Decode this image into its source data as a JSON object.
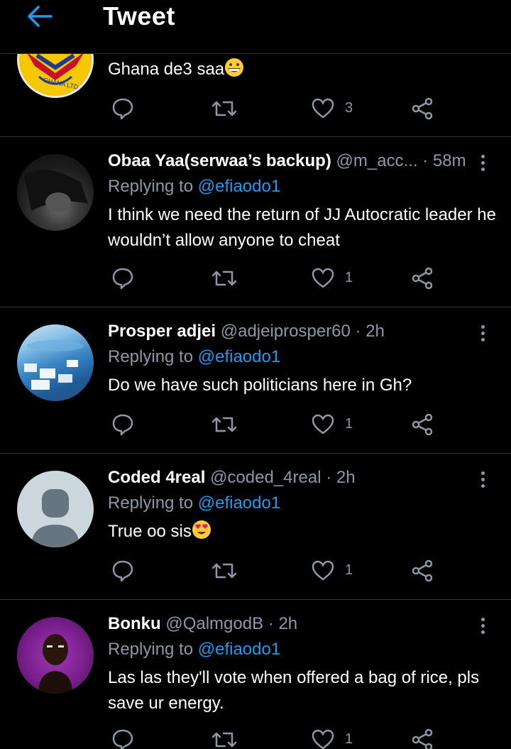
{
  "header": {
    "title": "Tweet"
  },
  "tweets": [
    {
      "text": "Ghana de3 saa",
      "emoji": "grinning-face-emoji",
      "likes": "3",
      "avatar_label": "GHANA LTD"
    },
    {
      "name": "Obaa Yaa(serwaa’s backup)",
      "handle": "@m_acc...",
      "time": "· 58m",
      "replying_prefix": "Replying to",
      "replying_to": "@efiaodo1",
      "text": "I think we need the return of JJ Autocratic leader he wouldn’t allow anyone to cheat",
      "likes": "1"
    },
    {
      "name": "Prosper adjei",
      "handle": "@adjeiprosper60",
      "time": "· 2h",
      "replying_prefix": "Replying to",
      "replying_to": "@efiaodo1",
      "text": "Do we have such politicians here in Gh?",
      "likes": "1"
    },
    {
      "name": "Coded 4real",
      "handle": "@coded_4real",
      "time": "· 2h",
      "replying_prefix": "Replying to",
      "replying_to": "@efiaodo1",
      "text": "True oo sis",
      "emoji": "heart-eyes-emoji",
      "likes": "1"
    },
    {
      "name": "Bonku",
      "handle": "@QalmgodB",
      "time": "· 2h",
      "replying_prefix": "Replying to",
      "replying_to": "@efiaodo1",
      "text": "Las las they'll vote when offered a bag of rice, pls save ur energy.",
      "likes": "1"
    }
  ],
  "colors": {
    "background": "#000000",
    "accent": "#1d9bf0",
    "muted": "#8b98a5",
    "divider": "#2f3336"
  }
}
